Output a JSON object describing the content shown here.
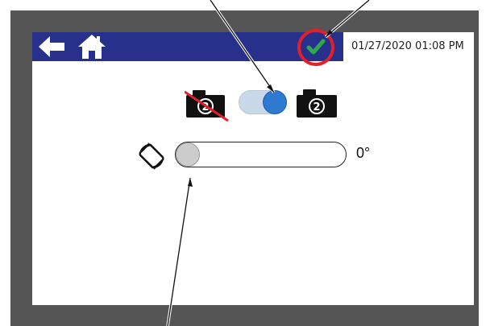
{
  "header": {
    "datetime": "01/27/2020 01:08 PM",
    "back_icon": "back-arrow-icon",
    "home_icon": "home-icon",
    "status_icon": "check-icon",
    "status_color": "#2eaa4a"
  },
  "camera_toggle": {
    "left_icon": "camera-off-icon",
    "right_icon": "camera-icon",
    "camera_number": "2",
    "state": "on"
  },
  "rotation": {
    "icon": "rotate-screen-icon",
    "value_label": "0°",
    "value": 0
  },
  "colors": {
    "header_bar": "#27318c",
    "highlight_ring": "#e0202a",
    "toggle_on": "#2f7ad1"
  }
}
